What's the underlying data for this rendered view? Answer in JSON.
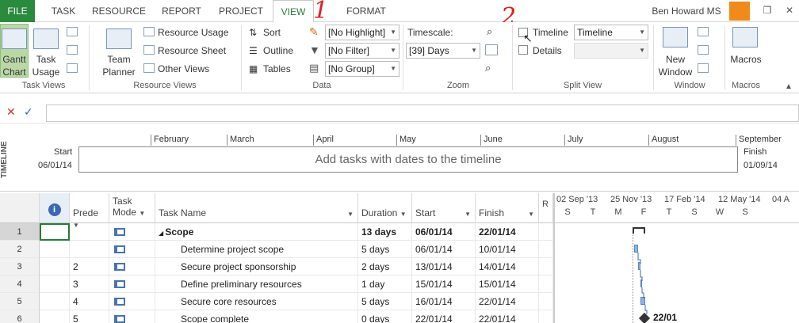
{
  "tabs": {
    "file": "FILE",
    "items": [
      "TASK",
      "RESOURCE",
      "REPORT",
      "PROJECT",
      "VIEW",
      "FORMAT"
    ],
    "active": "VIEW"
  },
  "user": {
    "name": "Ben Howard MS"
  },
  "ribbon": {
    "task_views": {
      "gantt_line1": "Gantt",
      "gantt_line2": "Chart",
      "usage_line1": "Task",
      "usage_line2": "Usage",
      "label": "Task Views"
    },
    "resource_views": {
      "team_line1": "Team",
      "team_line2": "Planner",
      "usage": "Resource Usage",
      "sheet": "Resource Sheet",
      "other": "Other Views",
      "label": "Resource Views"
    },
    "data": {
      "sort": "Sort",
      "outline": "Outline",
      "tables": "Tables",
      "highlight": "[No Highlight]",
      "filter": "[No Filter]",
      "group": "[No Group]",
      "label": "Data"
    },
    "zoom": {
      "timescale_label": "Timescale:",
      "timescale_value": "[39] Days",
      "label": "Zoom"
    },
    "split_view": {
      "timeline": "Timeline",
      "timeline_value": "Timeline",
      "details": "Details",
      "label": "Split View"
    },
    "window": {
      "new_line1": "New",
      "new_line2": "Window",
      "label": "Window"
    },
    "macros": {
      "button": "Macros",
      "label": "Macros"
    }
  },
  "annotations": {
    "one": "1",
    "two": "2"
  },
  "timeline": {
    "vertical_label": "TIMELINE",
    "start_label": "Start",
    "start_date": "06/01/14",
    "finish_label": "Finish",
    "finish_date": "01/09/14",
    "placeholder": "Add tasks with dates to the timeline",
    "months": [
      "February",
      "March",
      "April",
      "May",
      "June",
      "July",
      "August",
      "September"
    ]
  },
  "grid": {
    "headers": {
      "predecessors": "Prede",
      "task_mode_1": "Task",
      "task_mode_2": "Mode",
      "task_name": "Task Name",
      "duration": "Duration",
      "start": "Start",
      "finish": "Finish",
      "r": "R"
    },
    "rows": [
      {
        "num": "1",
        "pred": "",
        "name": "Scope",
        "duration": "13 days",
        "start": "06/01/14",
        "finish": "22/01/14",
        "summary": true
      },
      {
        "num": "2",
        "pred": "",
        "name": "Determine project scope",
        "duration": "5 days",
        "start": "06/01/14",
        "finish": "10/01/14",
        "summary": false
      },
      {
        "num": "3",
        "pred": "2",
        "name": "Secure project sponsorship",
        "duration": "2 days",
        "start": "13/01/14",
        "finish": "14/01/14",
        "summary": false
      },
      {
        "num": "4",
        "pred": "3",
        "name": "Define preliminary resources",
        "duration": "1 day",
        "start": "15/01/14",
        "finish": "15/01/14",
        "summary": false
      },
      {
        "num": "5",
        "pred": "4",
        "name": "Secure core resources",
        "duration": "5 days",
        "start": "16/01/14",
        "finish": "22/01/14",
        "summary": false
      },
      {
        "num": "6",
        "pred": "5",
        "name": "Scope complete",
        "duration": "0 days",
        "start": "22/01/14",
        "finish": "22/01/14",
        "summary": false
      }
    ]
  },
  "gantt": {
    "top_dates": [
      "02 Sep '13",
      "25 Nov '13",
      "17 Feb '14",
      "12 May '14",
      "04 A"
    ],
    "day_letters": [
      "S",
      "T",
      "M",
      "F",
      "T",
      "S",
      "W",
      "S"
    ],
    "milestone_label": "22/01"
  },
  "colors": {
    "file_tab": "#2a8a3e",
    "active_tab": "#2a7a3a",
    "bar": "#8fb4e3",
    "annotation": "#e02020"
  }
}
